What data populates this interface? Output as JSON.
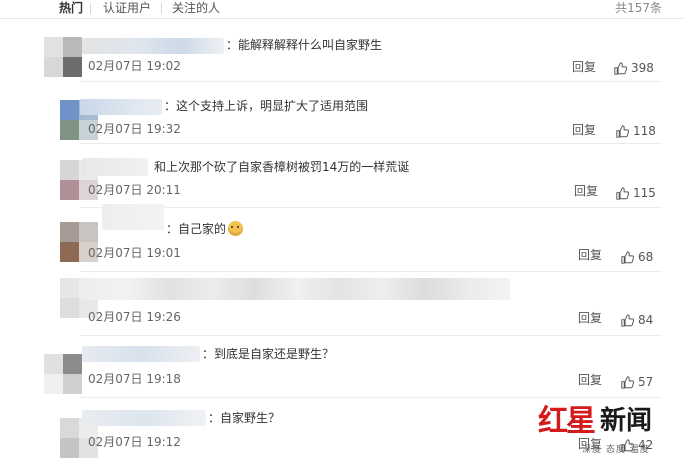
{
  "header": {
    "tabs": [
      "热门",
      "认证用户",
      "关注的人"
    ],
    "total": "共157条"
  },
  "comments": [
    {
      "text": "：能解释解释什么叫自家野生",
      "time": "02月07日 19:02",
      "reply": "回复",
      "likes": "398"
    },
    {
      "text": "：这个支持上诉，明显扩大了适用范围",
      "time": "02月07日 19:32",
      "reply": "回复",
      "likes": "118"
    },
    {
      "text": "和上次那个砍了自家香樟树被罚14万的一样荒诞",
      "time": "02月07日 20:11",
      "reply": "回复",
      "likes": "115"
    },
    {
      "text": "：自己家的",
      "time": "02月07日 19:01",
      "reply": "回复",
      "likes": "68"
    },
    {
      "text": "",
      "time": "02月07日 19:26",
      "reply": "回复",
      "likes": "84"
    },
    {
      "text": "：到底是自家还是野生？",
      "time": "02月07日 19:18",
      "reply": "回复",
      "likes": "57"
    },
    {
      "text": "：自家野生？",
      "time": "02月07日 19:12",
      "reply": "回复",
      "likes": "42"
    }
  ],
  "watermark": {
    "logo_red": "红星",
    "logo_black": "新闻",
    "slogan": "深度 态度 温度"
  },
  "colors": {
    "divider": "#ececec",
    "brand_red": "#d31b1b",
    "text": "#333333",
    "muted": "#666666"
  }
}
